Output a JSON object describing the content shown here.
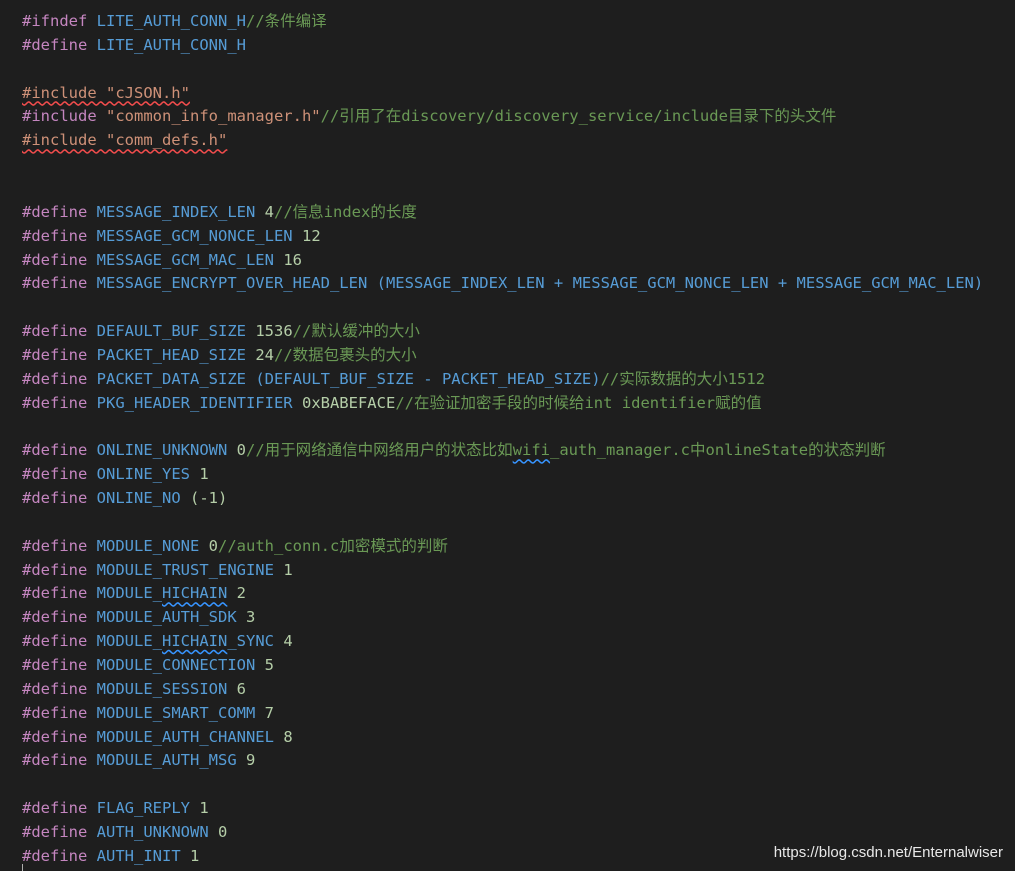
{
  "editor": {
    "lines": [
      {
        "spans": [
          {
            "t": "#ifndef",
            "c": "kw"
          },
          {
            "t": " "
          },
          {
            "t": "LITE_AUTH_CONN_H",
            "c": "mac"
          },
          {
            "t": "//条件编译",
            "c": "cmt"
          }
        ]
      },
      {
        "spans": [
          {
            "t": "#define",
            "c": "kw"
          },
          {
            "t": " "
          },
          {
            "t": "LITE_AUTH_CONN_H",
            "c": "mac"
          }
        ]
      },
      {
        "spans": []
      },
      {
        "spans": [
          {
            "t": "#include \"cJSON.h\"",
            "c": "str err"
          }
        ]
      },
      {
        "spans": [
          {
            "t": "#include",
            "c": "kw"
          },
          {
            "t": " "
          },
          {
            "t": "\"common_info_manager.h\"",
            "c": "str"
          },
          {
            "t": "//引用了在discovery/discovery_service/include目录下的头文件",
            "c": "cmt"
          }
        ]
      },
      {
        "spans": [
          {
            "t": "#include \"comm_defs.h\"",
            "c": "str err"
          }
        ]
      },
      {
        "spans": []
      },
      {
        "spans": []
      },
      {
        "spans": [
          {
            "t": "#define",
            "c": "kw"
          },
          {
            "t": " "
          },
          {
            "t": "MESSAGE_INDEX_LEN",
            "c": "mac"
          },
          {
            "t": " "
          },
          {
            "t": "4",
            "c": "num"
          },
          {
            "t": "//信息index的长度",
            "c": "cmt"
          }
        ]
      },
      {
        "spans": [
          {
            "t": "#define",
            "c": "kw"
          },
          {
            "t": " "
          },
          {
            "t": "MESSAGE_GCM_NONCE_LEN",
            "c": "mac"
          },
          {
            "t": " "
          },
          {
            "t": "12",
            "c": "num"
          }
        ]
      },
      {
        "spans": [
          {
            "t": "#define",
            "c": "kw"
          },
          {
            "t": " "
          },
          {
            "t": "MESSAGE_GCM_MAC_LEN",
            "c": "mac"
          },
          {
            "t": " "
          },
          {
            "t": "16",
            "c": "num"
          }
        ]
      },
      {
        "spans": [
          {
            "t": "#define",
            "c": "kw"
          },
          {
            "t": " "
          },
          {
            "t": "MESSAGE_ENCRYPT_OVER_HEAD_LEN",
            "c": "mac"
          },
          {
            "t": " (MESSAGE_INDEX_LEN + MESSAGE_GCM_NONCE_LEN + MESSAGE_GCM_MAC_LEN)",
            "c": "op"
          }
        ]
      },
      {
        "spans": []
      },
      {
        "spans": [
          {
            "t": "#define",
            "c": "kw"
          },
          {
            "t": " "
          },
          {
            "t": "DEFAULT_BUF_SIZE",
            "c": "mac"
          },
          {
            "t": " "
          },
          {
            "t": "1536",
            "c": "num"
          },
          {
            "t": "//默认缓冲的大小",
            "c": "cmt"
          }
        ]
      },
      {
        "spans": [
          {
            "t": "#define",
            "c": "kw"
          },
          {
            "t": " "
          },
          {
            "t": "PACKET_HEAD_SIZE",
            "c": "mac"
          },
          {
            "t": " "
          },
          {
            "t": "24",
            "c": "num"
          },
          {
            "t": "//数据包裹头的大小",
            "c": "cmt"
          }
        ]
      },
      {
        "spans": [
          {
            "t": "#define",
            "c": "kw"
          },
          {
            "t": " "
          },
          {
            "t": "PACKET_DATA_SIZE",
            "c": "mac"
          },
          {
            "t": " (DEFAULT_BUF_SIZE - PACKET_HEAD_SIZE)",
            "c": "op"
          },
          {
            "t": "//实际数据的大小1512",
            "c": "cmt"
          }
        ]
      },
      {
        "spans": [
          {
            "t": "#define",
            "c": "kw"
          },
          {
            "t": " "
          },
          {
            "t": "PKG_HEADER_IDENTIFIER",
            "c": "mac"
          },
          {
            "t": " "
          },
          {
            "t": "0xBABEFACE",
            "c": "num"
          },
          {
            "t": "//在验证加密手段的时候给int identifier赋的值",
            "c": "cmt"
          }
        ]
      },
      {
        "spans": []
      },
      {
        "spans": [
          {
            "t": "#define",
            "c": "kw"
          },
          {
            "t": " "
          },
          {
            "t": "ONLINE_UNKNOWN",
            "c": "mac"
          },
          {
            "t": " "
          },
          {
            "t": "0",
            "c": "num"
          },
          {
            "t": "//用于网络通信中网络用户的状态比如",
            "c": "cmt"
          },
          {
            "t": "wifi",
            "c": "cmt info"
          },
          {
            "t": "_auth_manager.c中onlineState的状态判断",
            "c": "cmt"
          }
        ]
      },
      {
        "spans": [
          {
            "t": "#define",
            "c": "kw"
          },
          {
            "t": " "
          },
          {
            "t": "ONLINE_YES",
            "c": "mac"
          },
          {
            "t": " "
          },
          {
            "t": "1",
            "c": "num"
          }
        ]
      },
      {
        "spans": [
          {
            "t": "#define",
            "c": "kw"
          },
          {
            "t": " "
          },
          {
            "t": "ONLINE_NO",
            "c": "mac"
          },
          {
            "t": " (-1)",
            "c": "num"
          }
        ]
      },
      {
        "spans": []
      },
      {
        "spans": [
          {
            "t": "#define",
            "c": "kw"
          },
          {
            "t": " "
          },
          {
            "t": "MODULE_NONE",
            "c": "mac"
          },
          {
            "t": " "
          },
          {
            "t": "0",
            "c": "num"
          },
          {
            "t": "//auth_conn.c加密模式的判断",
            "c": "cmt"
          }
        ]
      },
      {
        "spans": [
          {
            "t": "#define",
            "c": "kw"
          },
          {
            "t": " "
          },
          {
            "t": "MODULE_TRUST_ENGINE",
            "c": "mac"
          },
          {
            "t": " "
          },
          {
            "t": "1",
            "c": "num"
          }
        ]
      },
      {
        "spans": [
          {
            "t": "#define",
            "c": "kw"
          },
          {
            "t": " "
          },
          {
            "t": "MODULE_",
            "c": "mac"
          },
          {
            "t": "HICHAIN",
            "c": "mac info"
          },
          {
            "t": " "
          },
          {
            "t": "2",
            "c": "num"
          }
        ]
      },
      {
        "spans": [
          {
            "t": "#define",
            "c": "kw"
          },
          {
            "t": " "
          },
          {
            "t": "MODULE_AUTH_SDK",
            "c": "mac"
          },
          {
            "t": " "
          },
          {
            "t": "3",
            "c": "num"
          }
        ]
      },
      {
        "spans": [
          {
            "t": "#define",
            "c": "kw"
          },
          {
            "t": " "
          },
          {
            "t": "MODULE_",
            "c": "mac"
          },
          {
            "t": "HICHAIN",
            "c": "mac info"
          },
          {
            "t": "_SYNC",
            "c": "mac"
          },
          {
            "t": " "
          },
          {
            "t": "4",
            "c": "num"
          }
        ]
      },
      {
        "spans": [
          {
            "t": "#define",
            "c": "kw"
          },
          {
            "t": " "
          },
          {
            "t": "MODULE_CONNECTION",
            "c": "mac"
          },
          {
            "t": " "
          },
          {
            "t": "5",
            "c": "num"
          }
        ]
      },
      {
        "spans": [
          {
            "t": "#define",
            "c": "kw"
          },
          {
            "t": " "
          },
          {
            "t": "MODULE_SESSION",
            "c": "mac"
          },
          {
            "t": " "
          },
          {
            "t": "6",
            "c": "num"
          }
        ]
      },
      {
        "spans": [
          {
            "t": "#define",
            "c": "kw"
          },
          {
            "t": " "
          },
          {
            "t": "MODULE_SMART_COMM",
            "c": "mac"
          },
          {
            "t": " "
          },
          {
            "t": "7",
            "c": "num"
          }
        ]
      },
      {
        "spans": [
          {
            "t": "#define",
            "c": "kw"
          },
          {
            "t": " "
          },
          {
            "t": "MODULE_AUTH_CHANNEL",
            "c": "mac"
          },
          {
            "t": " "
          },
          {
            "t": "8",
            "c": "num"
          }
        ]
      },
      {
        "spans": [
          {
            "t": "#define",
            "c": "kw"
          },
          {
            "t": " "
          },
          {
            "t": "MODULE_AUTH_MSG",
            "c": "mac"
          },
          {
            "t": " "
          },
          {
            "t": "9",
            "c": "num"
          }
        ]
      },
      {
        "spans": []
      },
      {
        "spans": [
          {
            "t": "#define",
            "c": "kw"
          },
          {
            "t": " "
          },
          {
            "t": "FLAG_REPLY",
            "c": "mac"
          },
          {
            "t": " "
          },
          {
            "t": "1",
            "c": "num"
          }
        ]
      },
      {
        "spans": [
          {
            "t": "#define",
            "c": "kw"
          },
          {
            "t": " "
          },
          {
            "t": "AUTH_UNKNOWN",
            "c": "mac"
          },
          {
            "t": " "
          },
          {
            "t": "0",
            "c": "num"
          }
        ]
      },
      {
        "spans": [
          {
            "t": "#define",
            "c": "kw"
          },
          {
            "t": " "
          },
          {
            "t": "AUTH_INIT",
            "c": "mac"
          },
          {
            "t": " "
          },
          {
            "t": "1",
            "c": "num"
          }
        ]
      }
    ]
  },
  "watermark": "https://blog.csdn.net/Enternalwiser",
  "colors": {
    "background": "#1e1e1e",
    "keyword": "#c586c0",
    "macro": "#569cd6",
    "number": "#b5cea8",
    "string": "#ce9178",
    "comment": "#6a9955",
    "error_squiggle": "#f14c4c",
    "info_squiggle": "#3794ff"
  }
}
